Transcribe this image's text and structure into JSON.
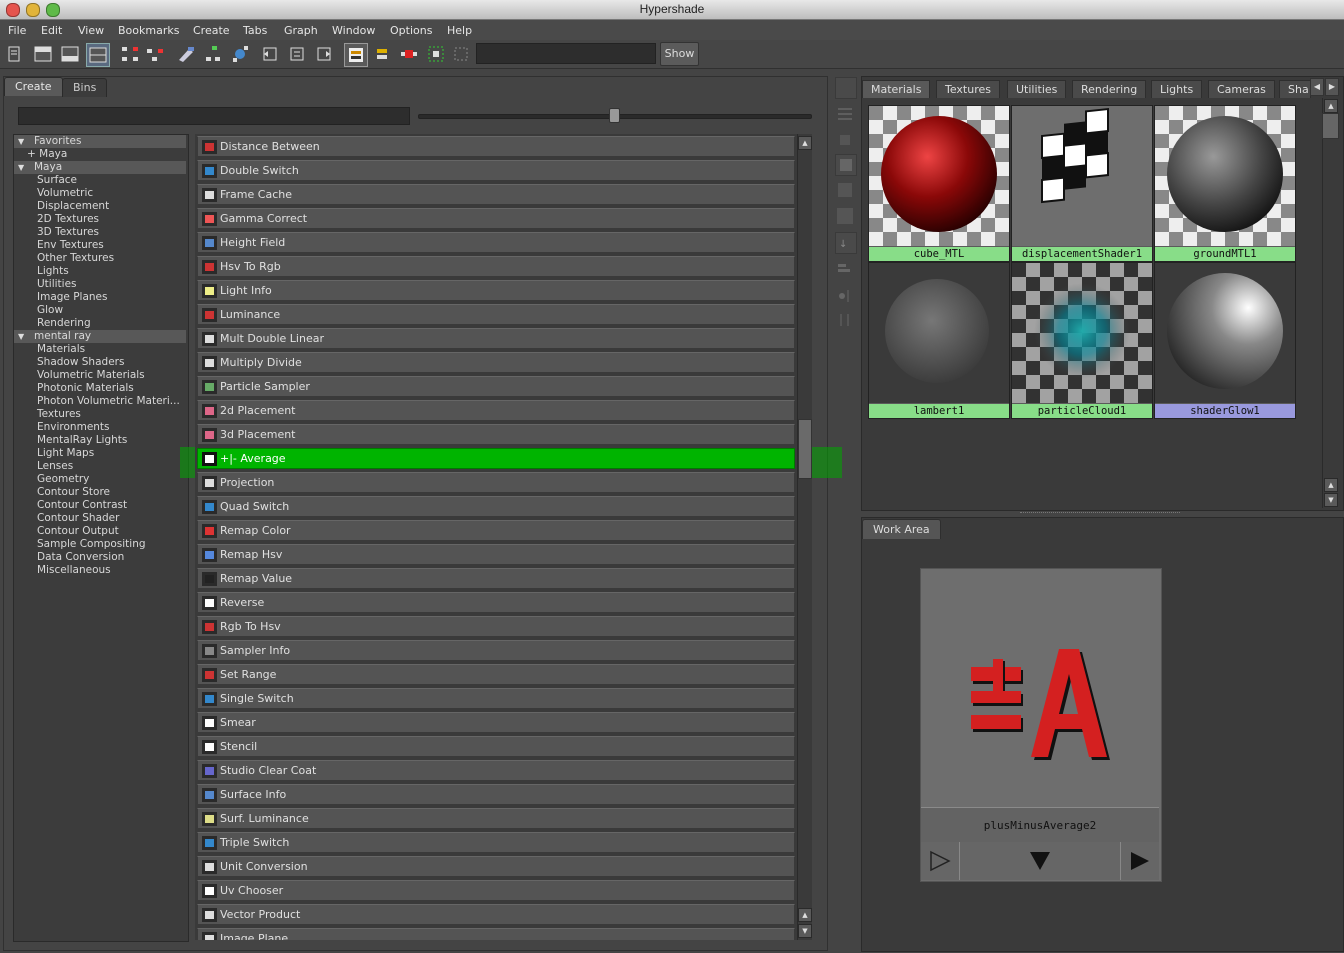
{
  "window": {
    "title": "Hypershade"
  },
  "menu": [
    "File",
    "Edit",
    "View",
    "Bookmarks",
    "Create",
    "Tabs",
    "Graph",
    "Window",
    "Options",
    "Help"
  ],
  "toolbar": {
    "show_label": "Show",
    "name_field_value": ""
  },
  "left_tabs": [
    "Create",
    "Bins"
  ],
  "tree": [
    {
      "label": "Favorites",
      "type": "section",
      "expanded": true
    },
    {
      "label": "+ Maya",
      "type": "child"
    },
    {
      "label": "Maya",
      "type": "section",
      "expanded": true
    },
    {
      "label": "Surface",
      "type": "item"
    },
    {
      "label": "Volumetric",
      "type": "item"
    },
    {
      "label": "Displacement",
      "type": "item"
    },
    {
      "label": "2D Textures",
      "type": "item"
    },
    {
      "label": "3D Textures",
      "type": "item"
    },
    {
      "label": "Env Textures",
      "type": "item"
    },
    {
      "label": "Other Textures",
      "type": "item"
    },
    {
      "label": "Lights",
      "type": "item"
    },
    {
      "label": "Utilities",
      "type": "item"
    },
    {
      "label": "Image Planes",
      "type": "item"
    },
    {
      "label": "Glow",
      "type": "item"
    },
    {
      "label": "Rendering",
      "type": "item"
    },
    {
      "label": "mental ray",
      "type": "section",
      "expanded": true
    },
    {
      "label": "Materials",
      "type": "item"
    },
    {
      "label": "Shadow Shaders",
      "type": "item"
    },
    {
      "label": "Volumetric Materials",
      "type": "item"
    },
    {
      "label": "Photonic Materials",
      "type": "item"
    },
    {
      "label": "Photon Volumetric Materi...",
      "type": "item"
    },
    {
      "label": "Textures",
      "type": "item"
    },
    {
      "label": "Environments",
      "type": "item"
    },
    {
      "label": "MentalRay Lights",
      "type": "item"
    },
    {
      "label": "Light Maps",
      "type": "item"
    },
    {
      "label": "Lenses",
      "type": "item"
    },
    {
      "label": "Geometry",
      "type": "item"
    },
    {
      "label": "Contour Store",
      "type": "item"
    },
    {
      "label": "Contour Contrast",
      "type": "item"
    },
    {
      "label": "Contour Shader",
      "type": "item"
    },
    {
      "label": "Contour Output",
      "type": "item"
    },
    {
      "label": "Sample Compositing",
      "type": "item"
    },
    {
      "label": "Data Conversion",
      "type": "item"
    },
    {
      "label": "Miscellaneous",
      "type": "item"
    }
  ],
  "nodes": [
    {
      "label": "Distance Between",
      "icon": "distance-icon",
      "color": "#cc3333"
    },
    {
      "label": "Double Switch",
      "icon": "switch-icon",
      "color": "#3388cc"
    },
    {
      "label": "Frame Cache",
      "icon": "frame-cache-icon",
      "color": "#dddddd"
    },
    {
      "label": "Gamma Correct",
      "icon": "gamma-icon",
      "color": "#ee5555"
    },
    {
      "label": "Height Field",
      "icon": "height-field-icon",
      "color": "#5588cc"
    },
    {
      "label": "Hsv To Rgb",
      "icon": "hsv-rgb-icon",
      "color": "#cc3333"
    },
    {
      "label": "Light Info",
      "icon": "bulb-icon",
      "color": "#eeee88"
    },
    {
      "label": "Luminance",
      "icon": "luminance-icon",
      "color": "#cc3333"
    },
    {
      "label": "Mult Double Linear",
      "icon": "mult-double-icon",
      "color": "#dddddd"
    },
    {
      "label": "Multiply Divide",
      "icon": "multiply-divide-icon",
      "color": "#dddddd"
    },
    {
      "label": "Particle Sampler",
      "icon": "particle-icon",
      "color": "#66aa66"
    },
    {
      "label": "2d Placement",
      "icon": "placement-2d-icon",
      "color": "#dd6688"
    },
    {
      "label": "3d Placement",
      "icon": "placement-3d-icon",
      "color": "#dd6688"
    },
    {
      "label": "+|- Average",
      "icon": "plus-minus-average-icon",
      "color": "#ffffff",
      "selected": true
    },
    {
      "label": "Projection",
      "icon": "projection-icon",
      "color": "#dddddd"
    },
    {
      "label": "Quad Switch",
      "icon": "switch-icon",
      "color": "#3388cc"
    },
    {
      "label": "Remap Color",
      "icon": "remap-color-icon",
      "color": "#dd3333"
    },
    {
      "label": "Remap Hsv",
      "icon": "remap-hsv-icon",
      "color": "#5588dd"
    },
    {
      "label": "Remap Value",
      "icon": "remap-value-icon",
      "color": "#222222"
    },
    {
      "label": "Reverse",
      "icon": "reverse-icon",
      "color": "#ffffff"
    },
    {
      "label": "Rgb To Hsv",
      "icon": "rgb-hsv-icon",
      "color": "#cc3333"
    },
    {
      "label": "Sampler Info",
      "icon": "sampler-icon",
      "color": "#888888"
    },
    {
      "label": "Set Range",
      "icon": "set-range-icon",
      "color": "#cc3333"
    },
    {
      "label": "Single Switch",
      "icon": "switch-icon",
      "color": "#3388cc"
    },
    {
      "label": "Smear",
      "icon": "smear-icon",
      "color": "#ffffff"
    },
    {
      "label": "Stencil",
      "icon": "stencil-icon",
      "color": "#ffffff"
    },
    {
      "label": "Studio Clear Coat",
      "icon": "clear-coat-icon",
      "color": "#6666cc"
    },
    {
      "label": "Surface Info",
      "icon": "surface-info-icon",
      "color": "#5588cc"
    },
    {
      "label": "Surf. Luminance",
      "icon": "surf-luminance-icon",
      "color": "#dddd88"
    },
    {
      "label": "Triple Switch",
      "icon": "switch-icon",
      "color": "#3388cc"
    },
    {
      "label": "Unit Conversion",
      "icon": "unit-conversion-icon",
      "color": "#dddddd"
    },
    {
      "label": "Uv Chooser",
      "icon": "uv-chooser-icon",
      "color": "#ffffff"
    },
    {
      "label": "Vector Product",
      "icon": "vector-product-icon",
      "color": "#dddddd"
    },
    {
      "label": "Image Plane",
      "icon": "image-plane-icon",
      "color": "#dddddd"
    }
  ],
  "material_tabs": [
    "Materials",
    "Textures",
    "Utilities",
    "Rendering",
    "Lights",
    "Cameras",
    "Sha"
  ],
  "swatches": [
    {
      "name": "cube_MTL",
      "kind": "red-sphere",
      "cap_color": "#88dd88"
    },
    {
      "name": "displacementShader1",
      "kind": "checker-displace",
      "cap_color": "#88dd88"
    },
    {
      "name": "groundMTL1",
      "kind": "grey-sphere",
      "cap_color": "#88dd88"
    },
    {
      "name": "lambert1",
      "kind": "lambert",
      "cap_color": "#88dd88"
    },
    {
      "name": "particleCloud1",
      "kind": "particle-cloud",
      "cap_color": "#88dd88"
    },
    {
      "name": "shaderGlow1",
      "kind": "glow",
      "cap_color": "#9999dd"
    }
  ],
  "work_area": {
    "tab": "Work Area",
    "node_name": "plusMinusAverage2"
  },
  "colors": {
    "selection_green": "#00b400",
    "accent_red": "#d42020"
  }
}
